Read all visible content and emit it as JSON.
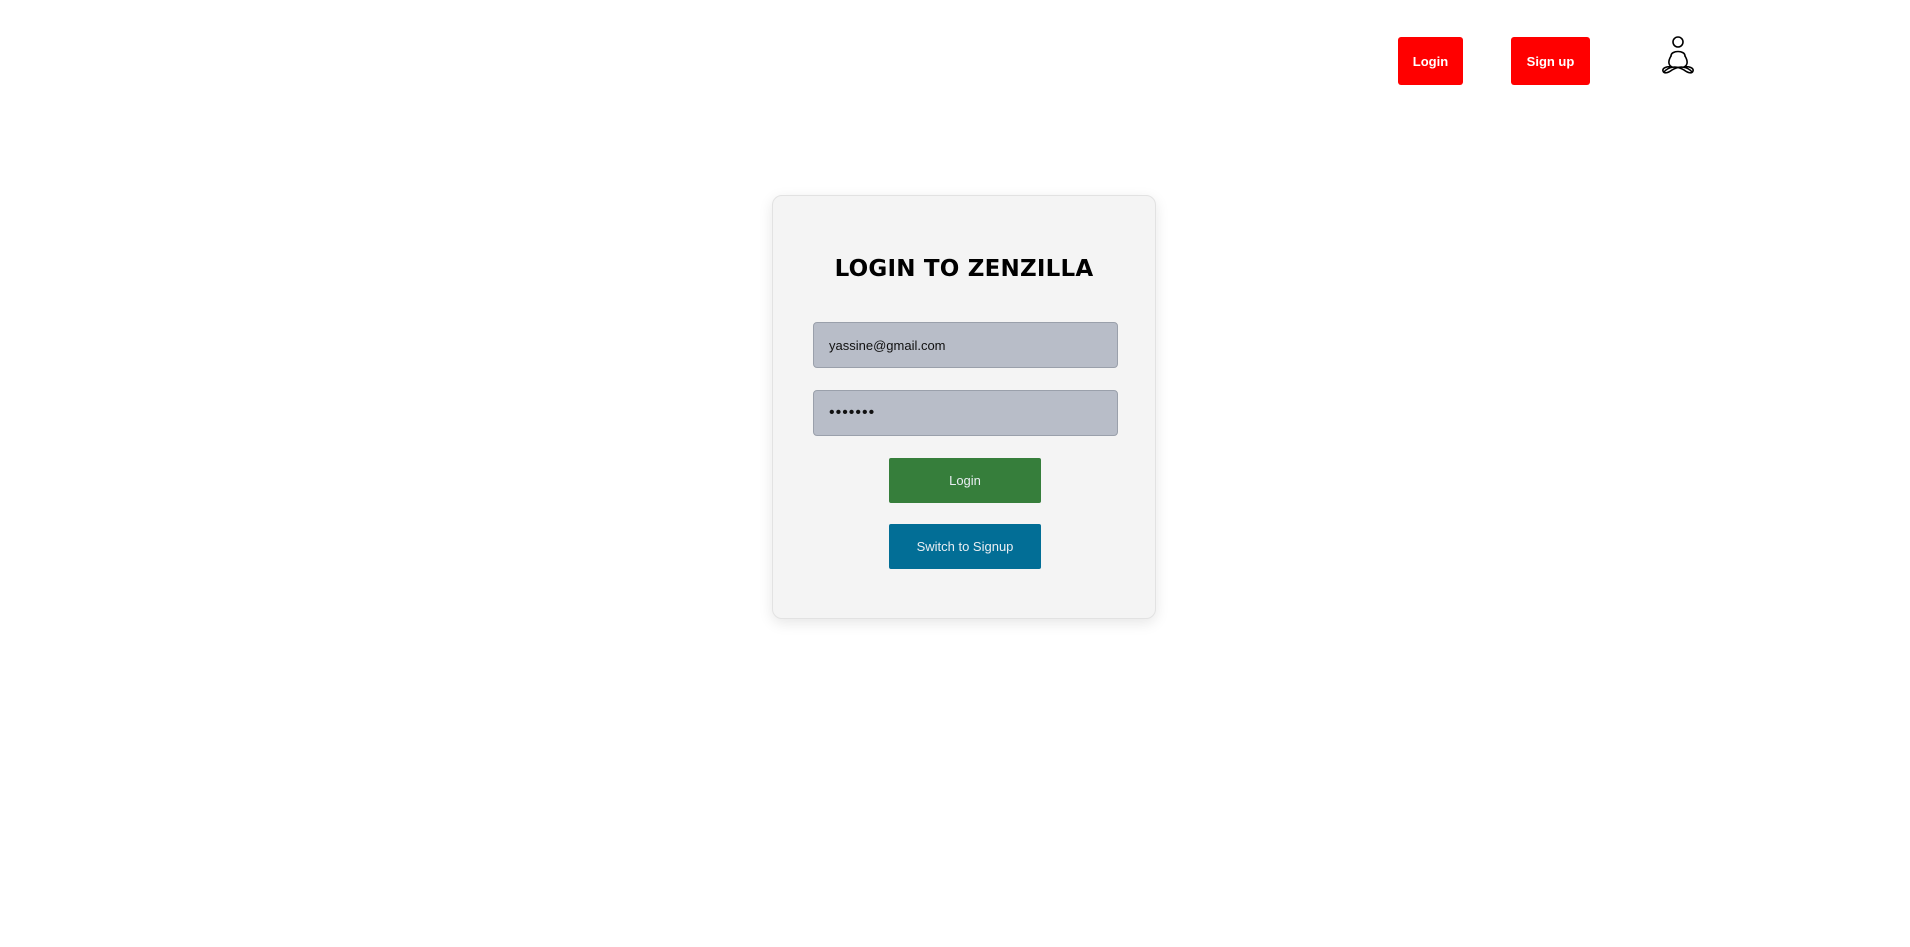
{
  "header": {
    "login_label": "Login",
    "signup_label": "Sign up",
    "logo_icon": "meditation-person-icon"
  },
  "login_card": {
    "title": "LOGIN TO ZENZILLA",
    "email_value": "yassine@gmail.com",
    "password_value": "yassine",
    "login_button_label": "Login",
    "switch_button_label": "Switch to Signup"
  },
  "colors": {
    "header_button_bg": "#ff0000",
    "login_button_bg": "#367e3b",
    "switch_button_bg": "#026e96",
    "input_bg": "#b8bdc8",
    "card_bg": "#f4f4f4"
  }
}
